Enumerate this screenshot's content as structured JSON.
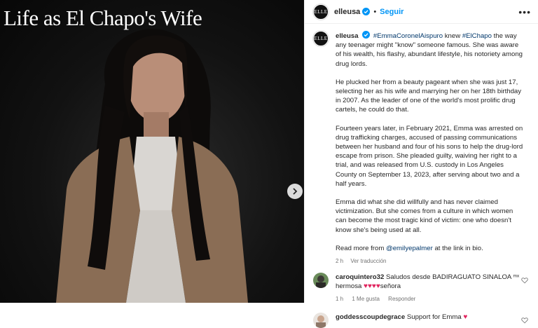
{
  "media": {
    "title": "Life as El Chapo's Wife"
  },
  "header": {
    "username": "elleusa",
    "separator": "•",
    "follow_label": "Seguir",
    "more_label": "•••",
    "avatar_text": "ELLE"
  },
  "caption": {
    "username": "elleusa",
    "mention": "#EmmaCoronelAispuro",
    "text1": " knew ",
    "hashtag": "#ElChapo",
    "text2": " the way any teenager might \"know\" someone famous. She was aware of his wealth, his flashy, abundant lifestyle, his notoriety among drug lords.",
    "para2": "He plucked her from a beauty pageant when she was just 17, selecting her as his wife and marrying her on her 18th birthday in 2007. As the leader of one of the world's most prolific drug cartels, he could do that.",
    "para3": "Fourteen years later, in February 2021, Emma was arrested on drug trafficking charges, accused of passing communications between her husband and four of his sons to help the drug-lord escape from prison. She pleaded guilty, waiving her right to a trial, and was released from U.S. custody in Los Angeles County on September 13, 2023, after serving about two and a half years.",
    "para4": "Emma did what she did willfully and has never claimed victimization. But she comes from a culture in which women can become the most tragic kind of victim: one who doesn't know she's being used at all.",
    "para5_prefix": "Read more from ",
    "para5_mention": "@emilyepalmer",
    "para5_suffix": " at the link in bio.",
    "time": "2 h",
    "translate": "Ver traducción"
  },
  "comments": [
    {
      "username": "caroquintero32",
      "text": " Saludos desde BADIRAGUATO SINALOA ᵐˣ hermosa ",
      "hearts": "♥♥♥♥",
      "text_end": "señora",
      "time": "1 h",
      "likes": "1 Me gusta",
      "reply": "Responder"
    },
    {
      "username": "goddesscoupdegrace",
      "text": " Support for Emma ",
      "hearts": "♥"
    }
  ],
  "colors": {
    "link": "#00376b",
    "follow": "#0095f6",
    "muted": "#737373"
  }
}
